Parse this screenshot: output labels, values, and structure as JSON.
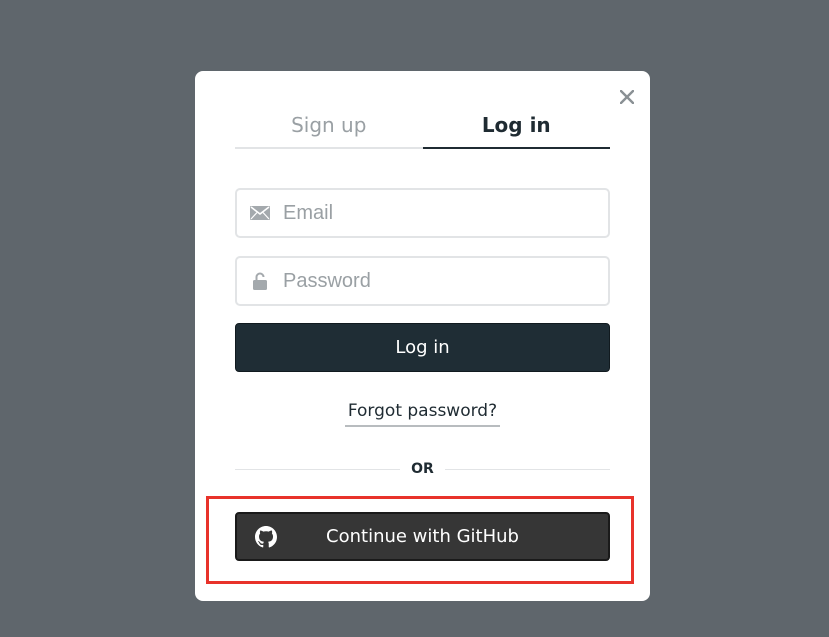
{
  "tabs": [
    {
      "label": "Sign up",
      "active": false
    },
    {
      "label": "Log in",
      "active": true
    }
  ],
  "email": {
    "placeholder": "Email",
    "value": "",
    "icon": "envelope-icon"
  },
  "password": {
    "placeholder": "Password",
    "value": "",
    "icon": "lock-icon"
  },
  "login_button": {
    "label": "Log in"
  },
  "forgot_link": {
    "label": "Forgot password?"
  },
  "divider": {
    "label": "OR"
  },
  "github_button": {
    "label": "Continue with GitHub",
    "icon": "github-icon"
  },
  "close": {
    "icon": "close-icon"
  },
  "colors": {
    "backdrop": "#5f666c",
    "primary": "#1f2d35",
    "github": "#363636",
    "highlight": "#e8322a"
  }
}
